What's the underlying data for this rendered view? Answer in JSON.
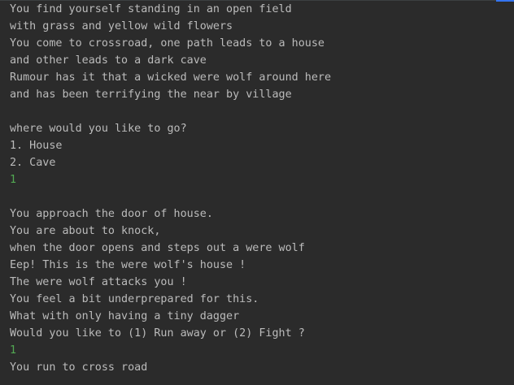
{
  "console": {
    "lines": [
      {
        "text": "You find yourself standing in an open field",
        "kind": "output"
      },
      {
        "text": "with grass and yellow wild flowers",
        "kind": "output"
      },
      {
        "text": "You come to crossroad, one path leads to a house",
        "kind": "output"
      },
      {
        "text": "and other leads to a dark cave",
        "kind": "output"
      },
      {
        "text": "Rumour has it that a wicked were wolf around here",
        "kind": "output"
      },
      {
        "text": "and has been terrifying the near by village",
        "kind": "output"
      },
      {
        "text": "",
        "kind": "output"
      },
      {
        "text": "where would you like to go?",
        "kind": "output"
      },
      {
        "text": "1. House",
        "kind": "output"
      },
      {
        "text": "2. Cave",
        "kind": "output"
      },
      {
        "text": "1",
        "kind": "input"
      },
      {
        "text": "",
        "kind": "output"
      },
      {
        "text": "You approach the door of house.",
        "kind": "output"
      },
      {
        "text": "You are about to knock,",
        "kind": "output"
      },
      {
        "text": "when the door opens and steps out a were wolf",
        "kind": "output"
      },
      {
        "text": "Eep! This is the were wolf's house !",
        "kind": "output"
      },
      {
        "text": "The were wolf attacks you !",
        "kind": "output"
      },
      {
        "text": "You feel a bit underprepared for this.",
        "kind": "output"
      },
      {
        "text": "What with only having a tiny dagger",
        "kind": "output"
      },
      {
        "text": "Would you like to (1) Run away or (2) Fight ?",
        "kind": "output"
      },
      {
        "text": "1",
        "kind": "input"
      },
      {
        "text": "You run to cross road",
        "kind": "output"
      }
    ]
  },
  "colors": {
    "background": "#2b2b2b",
    "output_text": "#bbbbbb",
    "input_text": "#52a852",
    "accent": "#3574f0"
  }
}
